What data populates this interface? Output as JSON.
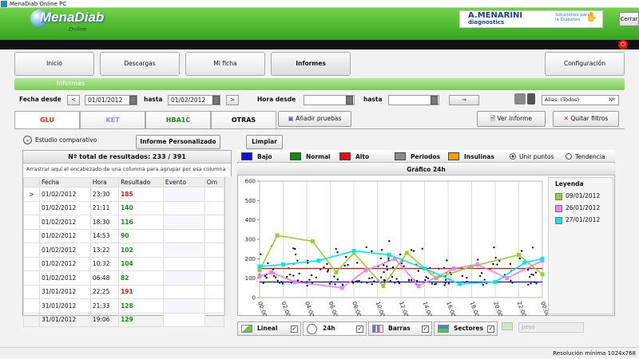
{
  "window": {
    "title": "MenaDiab Online PC",
    "close_label": "Cerrar"
  },
  "brand": {
    "logo": "MenaDiab",
    "logo_sub": "Online",
    "partner": "A.MENARINI",
    "partner_sub": "diagnostics",
    "solutions_line1": "Soluciones para",
    "solutions_line2": "la Diabetes"
  },
  "nav": [
    {
      "label": "Inicio"
    },
    {
      "label": "Descargas"
    },
    {
      "label": "Mi ficha"
    },
    {
      "label": "Informes"
    },
    {
      "label": "Configuración"
    }
  ],
  "section_title": "Informes",
  "filters": {
    "fecha_desde_label": "Fecha desde",
    "fecha_desde": "01/01/2012",
    "hasta_label": "hasta",
    "hasta": "01/02/2012",
    "hora_desde_label": "Hora desde",
    "hora_hasta_label": "hasta",
    "alias_label": "Alias: (Todos)",
    "alias_sub": "Nº"
  },
  "tabs": [
    "GLU",
    "KET",
    "HBA1C",
    "OTRAS"
  ],
  "tab_colors": {
    "GLU": "#d42020",
    "KET": "#9b8ad8",
    "HBA1C": "#1a8a1a",
    "OTRAS": "#000000"
  },
  "buttons": {
    "add_tests": "Añadir pruebas",
    "view_report": "Ver informe",
    "remove_filters": "Quitar filtros",
    "custom_report": "Informe Personalizado",
    "clear": "Limpiar"
  },
  "study": {
    "label": "Estudio comparativo"
  },
  "results": {
    "total": "Nº total de resultados: 233 / 391",
    "group_hint": "Arrastrar aquí el encabezado de una columna para agrupar por esa columna",
    "columns": [
      "Fecha",
      "Hora",
      "Resultado",
      "Evento",
      "Om"
    ],
    "rows": [
      {
        "fecha": "01/02/2012",
        "hora": "23:30",
        "resultado": "185",
        "color": "#d42020"
      },
      {
        "fecha": "01/02/2012",
        "hora": "21:11",
        "resultado": "140",
        "color": "#1a8a1a"
      },
      {
        "fecha": "01/02/2012",
        "hora": "18:30",
        "resultado": "116",
        "color": "#1a8a1a"
      },
      {
        "fecha": "01/02/2012",
        "hora": "14:53",
        "resultado": "90",
        "color": "#1a8a1a"
      },
      {
        "fecha": "01/02/2012",
        "hora": "13:22",
        "resultado": "102",
        "color": "#1a8a1a"
      },
      {
        "fecha": "01/02/2012",
        "hora": "10:32",
        "resultado": "104",
        "color": "#1a8a1a"
      },
      {
        "fecha": "01/02/2012",
        "hora": "06:48",
        "resultado": "82",
        "color": "#1a8a1a"
      },
      {
        "fecha": "31/01/2012",
        "hora": "22:25",
        "resultado": "191",
        "color": "#d42020"
      },
      {
        "fecha": "31/01/2012",
        "hora": "21:33",
        "resultado": "128",
        "color": "#1a8a1a"
      },
      {
        "fecha": "31/01/2012",
        "hora": "19:06",
        "resultado": "129",
        "color": "#1a8a1a"
      }
    ]
  },
  "chart_legend": [
    {
      "label": "Bajo",
      "color": "#1010e0"
    },
    {
      "label": "Normal",
      "color": "#138a13"
    },
    {
      "label": "Alto",
      "color": "#e01010"
    },
    {
      "label": "Periodos",
      "color": "#8a8a8a"
    },
    {
      "label": "Insulinas",
      "color": "#f5a000"
    }
  ],
  "chart_options": {
    "unir_puntos": "Unir puntos",
    "tendencia": "Tendencia"
  },
  "chart_data": {
    "type": "scatter",
    "title": "Gráfico 24h",
    "ylim": [
      0,
      600
    ],
    "yticks": [
      0,
      100,
      200,
      300,
      400,
      500,
      600
    ],
    "xticks": [
      "00:00",
      "02:00",
      "04:00",
      "06:00",
      "08:00",
      "10:00",
      "12:00",
      "14:00",
      "16:00",
      "18:00",
      "20:00",
      "22:00",
      "00:00"
    ],
    "reference_lines": [
      {
        "name": "Bajo",
        "value": 80,
        "color": "#1010e0"
      },
      {
        "name": "Alto",
        "value": 150,
        "color": "#e01010"
      }
    ],
    "legend_title": "Leyenda",
    "series": [
      {
        "name": "09/01/2012",
        "color": "#9acd32",
        "x": [
          0,
          1.5,
          4.5,
          6.5,
          8,
          10.5,
          12.5,
          15,
          18,
          22,
          24
        ],
        "y": [
          140,
          320,
          290,
          130,
          230,
          60,
          230,
          100,
          160,
          220,
          120
        ]
      },
      {
        "name": "26/01/2012",
        "color": "#ee82ee",
        "x": [
          0,
          1,
          3,
          7,
          9,
          11.5,
          13.5,
          16.5,
          18.5,
          21,
          24
        ],
        "y": [
          110,
          130,
          80,
          50,
          140,
          200,
          60,
          150,
          170,
          100,
          190
        ]
      },
      {
        "name": "27/01/2012",
        "color": "#00e5ee",
        "x": [
          0,
          2,
          5,
          8,
          11,
          14,
          17,
          20,
          22.5,
          24
        ],
        "y": [
          160,
          170,
          190,
          240,
          220,
          150,
          70,
          80,
          180,
          200
        ]
      }
    ]
  },
  "bottom_tabs": [
    "Lineal",
    "24h",
    "Barras",
    "Sectores"
  ],
  "peso_placeholder": "peso",
  "status": "Resolución mínima 1024x768"
}
